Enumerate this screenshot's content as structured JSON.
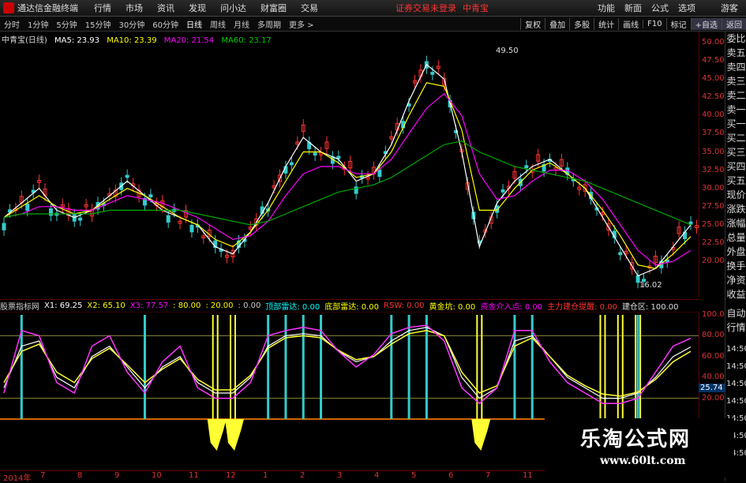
{
  "menubar": {
    "app_title": "通达信金融终端",
    "items": [
      "行情",
      "市场",
      "资讯",
      "发现",
      "问小达",
      "财富圈",
      "交易"
    ],
    "warning": "证券交易未登录",
    "stock": "中青宝",
    "right_items": [
      "功能",
      "新面",
      "公式",
      "选项"
    ],
    "user": "游客"
  },
  "periodbar": {
    "periods": [
      "分时",
      "1分钟",
      "5分钟",
      "15分钟",
      "30分钟",
      "60分钟",
      "日线",
      "周线",
      "月线",
      "多周期",
      "更多 >"
    ],
    "active_index": 6,
    "tools": [
      "复权",
      "叠加",
      "多股",
      "统计",
      "画线",
      "F10",
      "标记",
      "+自选",
      "返回"
    ]
  },
  "main_header": {
    "stock_label": "中青宝(日线)",
    "ma5": "MA5: 23.93",
    "ma10": "MA10: 23.39",
    "ma20": "MA20: 21.54",
    "ma60": "MA60: 23.17"
  },
  "price_scale": [
    "50.00",
    "47.50",
    "45.00",
    "42.50",
    "40.00",
    "37.50",
    "35.00",
    "32.50",
    "30.00",
    "27.50",
    "25.00",
    "22.50",
    "20.00"
  ],
  "price_marks": {
    "high": "49.50",
    "low": "16.02"
  },
  "side_panel": [
    "委比",
    "卖五",
    "卖四",
    "卖三",
    "卖二",
    "卖一",
    "买一",
    "买二",
    "买三",
    "买四",
    "买五",
    "现价",
    "涨跌",
    "涨幅",
    "总量",
    "外盘",
    "换手",
    "净资",
    "收益"
  ],
  "side_panel_bottom": [
    "自动",
    "行情"
  ],
  "indicator_header": {
    "name": "股票指标网",
    "x1": "X1: 69.25",
    "x2": "X2: 65.10",
    "x3": "X3: 77.57",
    "v80": ": 80.00",
    "v20": ": 20.00",
    "v0": ": 0.00",
    "top_radar": "顶部雷达: 0.00",
    "bottom_radar": "底部雷达: 0.00",
    "rsw": "RSW: 0.00",
    "gold": "黄金坑: 0.00",
    "funds_in": "资金介入点: 0.00",
    "main_build": "主力建仓提醒: 0.00",
    "build_zone": "建仓区: 100.00"
  },
  "indicator_scale": [
    "100.0",
    "80.00",
    "60.00",
    "40.00",
    "20.00"
  ],
  "indicator_right_times": [
    "14:50",
    "14:50",
    "14:50",
    "14:50",
    "14:50",
    "14:50",
    "14:50"
  ],
  "indicator_current": "25.74",
  "date_axis": [
    "2014年",
    "7",
    "8",
    "9",
    "10",
    "11",
    "12",
    "1",
    "2",
    "3",
    "4",
    "5",
    "6",
    "7",
    "11",
    "12"
  ],
  "watermark": {
    "title": "乐淘公式网",
    "url": "www.60lt.com"
  },
  "colors": {
    "up": "#ff3333",
    "down": "#33cccc",
    "ma5": "#ffffff",
    "ma10": "#ffff00",
    "ma20": "#ff00ff",
    "ma60": "#00aa00",
    "accent": "#dd3333"
  },
  "chart_data": [
    {
      "type": "line",
      "title": "中青宝(日线)",
      "series": [
        {
          "name": "MA5",
          "values": [
            26,
            28,
            30,
            27,
            26,
            27,
            29,
            31,
            29,
            27,
            26,
            25,
            22,
            21,
            24,
            28,
            33,
            37,
            35,
            34,
            31,
            32,
            36,
            42,
            47,
            45,
            35,
            22,
            28,
            31,
            33,
            34,
            32,
            30,
            26,
            22,
            18,
            19,
            22,
            25
          ]
        },
        {
          "name": "MA10",
          "values": [
            26,
            27.5,
            29,
            27.5,
            26.5,
            27,
            28.5,
            30,
            29,
            27.5,
            26,
            25,
            23,
            22,
            24,
            27,
            31,
            35,
            35,
            33.5,
            31.5,
            32,
            35,
            40,
            44.5,
            44,
            38,
            27,
            27,
            30,
            32.5,
            33.5,
            32,
            30,
            27,
            23.5,
            19.5,
            19,
            21,
            23.4
          ]
        },
        {
          "name": "MA20",
          "values": [
            26,
            26.5,
            27.5,
            27.5,
            27,
            27,
            28,
            29,
            28.5,
            28,
            27,
            26,
            24.5,
            23,
            23.5,
            25.5,
            29,
            32,
            33,
            33,
            32,
            32,
            34,
            37.5,
            41,
            43,
            40,
            32,
            28.5,
            29,
            31,
            32.5,
            32.5,
            31,
            28.5,
            25,
            21.5,
            19.5,
            20,
            21.5
          ]
        },
        {
          "name": "MA60",
          "values": [
            26,
            26.5,
            26.5,
            26.5,
            26.5,
            26.5,
            27,
            27,
            27,
            27,
            27,
            26.5,
            26,
            25.5,
            25,
            25.5,
            26.5,
            27.5,
            28.5,
            29.5,
            30,
            30.5,
            31.5,
            33,
            34.5,
            36,
            36.5,
            35,
            34,
            33,
            32.5,
            32,
            31.5,
            31,
            30,
            29,
            28,
            27,
            26,
            25
          ]
        }
      ],
      "ylim": [
        16,
        50
      ],
      "annotations": [
        "49.50",
        "16.02"
      ]
    },
    {
      "type": "line",
      "title": "股票指标网",
      "series": [
        {
          "name": "X1",
          "values": [
            30,
            70,
            75,
            40,
            30,
            60,
            70,
            50,
            30,
            50,
            60,
            35,
            25,
            25,
            40,
            70,
            80,
            82,
            80,
            65,
            55,
            60,
            75,
            85,
            88,
            80,
            40,
            20,
            30,
            75,
            80,
            60,
            40,
            30,
            20,
            20,
            25,
            40,
            60,
            69.25
          ]
        },
        {
          "name": "X2",
          "values": [
            35,
            65,
            72,
            45,
            35,
            58,
            68,
            52,
            35,
            48,
            58,
            38,
            28,
            28,
            42,
            68,
            78,
            80,
            78,
            66,
            57,
            60,
            72,
            82,
            85,
            80,
            45,
            25,
            32,
            70,
            78,
            60,
            42,
            32,
            24,
            22,
            26,
            38,
            55,
            65.1
          ]
        },
        {
          "name": "X3",
          "values": [
            25,
            85,
            80,
            35,
            25,
            70,
            80,
            45,
            25,
            55,
            70,
            30,
            20,
            20,
            35,
            80,
            85,
            88,
            85,
            65,
            50,
            62,
            82,
            88,
            90,
            75,
            30,
            15,
            30,
            85,
            85,
            55,
            35,
            25,
            15,
            15,
            20,
            45,
            70,
            77.57
          ]
        }
      ],
      "ylim": [
        0,
        100
      ]
    }
  ]
}
